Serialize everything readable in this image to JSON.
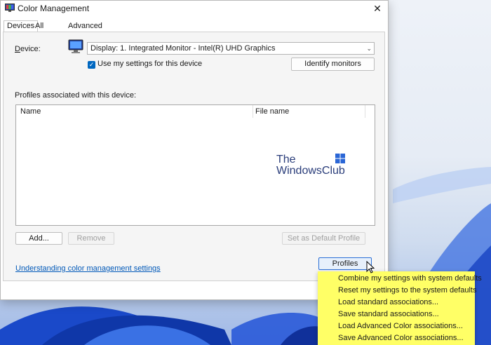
{
  "window": {
    "title": "Color Management",
    "close_glyph": "✕",
    "tabs": [
      {
        "label": "Devices",
        "active": true
      },
      {
        "label": "All Profiles",
        "active": false
      },
      {
        "label": "Advanced",
        "active": false
      }
    ]
  },
  "devices": {
    "device_label": "Device:",
    "device_value": "Display: 1. Integrated Monitor - Intel(R) UHD Graphics",
    "use_settings_label": "Use my settings for this device",
    "use_settings_checked": true,
    "identify_button": "Identify monitors",
    "profiles_label": "Profiles associated with this device:",
    "table_columns": [
      "Name",
      "File name"
    ],
    "add_button": "Add...",
    "remove_button": "Remove",
    "set_default_button": "Set as Default Profile",
    "understanding_link": "Understanding color management settings",
    "profiles_button": "Profiles"
  },
  "watermark": {
    "line1": "The",
    "line2": "WindowsClub"
  },
  "profiles_menu": {
    "highlight_color": "#ffff66",
    "items": [
      "Combine my settings with system defaults",
      "Reset my settings to the system defaults",
      "Load standard associations...",
      "Save standard associations...",
      "Load Advanced Color associations...",
      "Save Advanced Color associations..."
    ]
  },
  "colors": {
    "accent": "#0067c0",
    "link": "#0058b8"
  }
}
